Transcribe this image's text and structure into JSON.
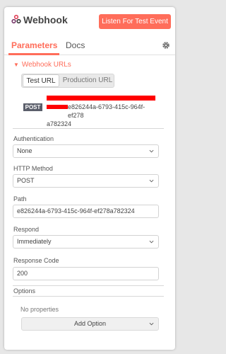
{
  "header": {
    "title": "Webhook",
    "listen_button": "Listen For Test Event",
    "brand_color": "#ff6d5a"
  },
  "tabs": [
    {
      "label": "Parameters",
      "active": true
    },
    {
      "label": "Docs",
      "active": false
    }
  ],
  "webhook_urls": {
    "section_label": "Webhook URLs",
    "url_tabs": [
      {
        "label": "Test URL",
        "active": true
      },
      {
        "label": "Production URL",
        "active": false
      }
    ],
    "method_badge": "POST",
    "url_line1": "e826244a-6793-415c-964f-ef278",
    "url_line2": "a782324"
  },
  "fields": {
    "authentication": {
      "label": "Authentication",
      "value": "None"
    },
    "http_method": {
      "label": "HTTP Method",
      "value": "POST"
    },
    "path": {
      "label": "Path",
      "value": "e826244a-6793-415c-964f-ef278a782324"
    },
    "respond": {
      "label": "Respond",
      "value": "Immediately"
    },
    "response_code": {
      "label": "Response Code",
      "value": "200"
    }
  },
  "options": {
    "label": "Options",
    "empty_text": "No properties",
    "add_button": "Add Option"
  }
}
